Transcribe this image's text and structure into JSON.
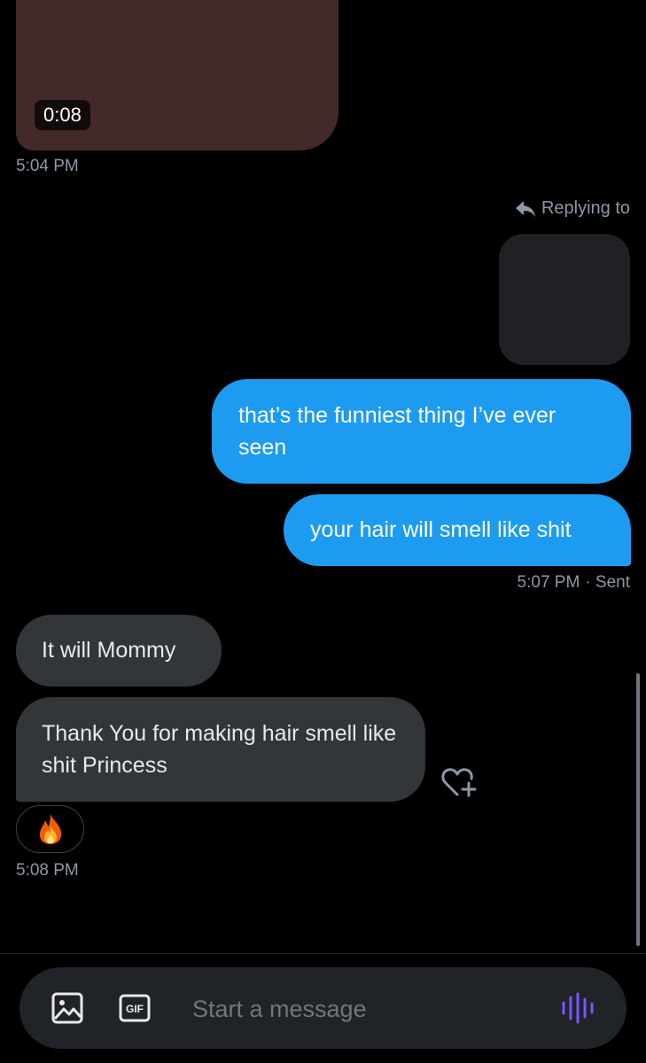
{
  "video": {
    "duration": "0:08",
    "timestamp": "5:04 PM"
  },
  "reply_context": {
    "label": "Replying to"
  },
  "outgoing": {
    "messages": [
      "that’s the funniest thing I’ve ever seen",
      "your hair will smell like shit"
    ],
    "timestamp": "5:07 PM",
    "status": "· Sent"
  },
  "incoming": {
    "messages": [
      "It will Mommy",
      "Thank You for making hair smell like shit Princess"
    ],
    "reaction_emoji": "🔥",
    "timestamp": "5:08 PM"
  },
  "composer": {
    "placeholder": "Start a message",
    "gif_label": "GIF"
  },
  "colors": {
    "outgoing_bubble": "#1d9bf0",
    "incoming_bubble": "#333639",
    "voice_accent": "#7856ff"
  }
}
